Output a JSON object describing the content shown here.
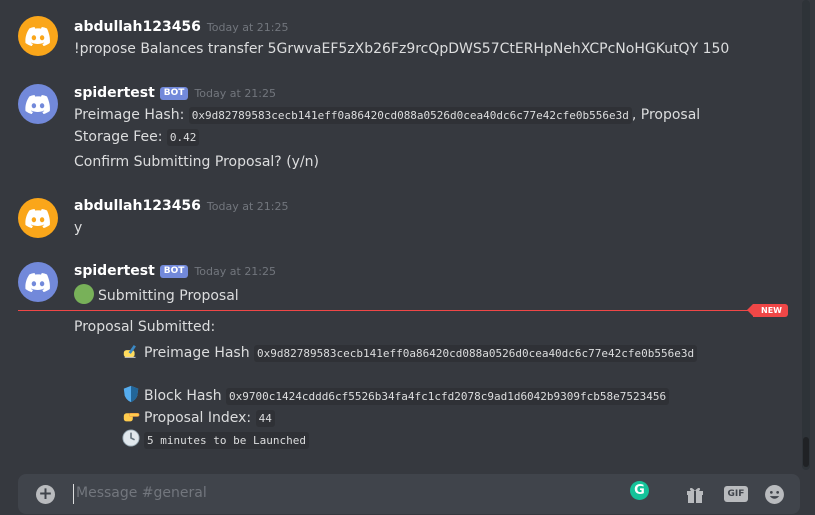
{
  "messages": [
    {
      "author": "abdullah123456",
      "timestamp": "Today at 21:25",
      "text": "!propose Balances transfer 5GrwvaEF5zXb26Fz9rcQpDWS57CtERHpNehXCPcNoHGKutQY 150"
    },
    {
      "author": "spidertest",
      "bot_badge": "BOT",
      "timestamp": "Today at 21:25",
      "preimage_label": "Preimage Hash:",
      "preimage_hash": "0x9d82789583cecb141eff0a86420cd088a0526d0cea40dc6c77e42cfe0b556e3d",
      "proposal_suffix": ", Proposal",
      "storage_fee_label": "Storage Fee:",
      "storage_fee": "0.42",
      "confirm": "Confirm Submitting Proposal? (y/n)"
    },
    {
      "author": "abdullah123456",
      "timestamp": "Today at 21:25",
      "text": "y"
    },
    {
      "author": "spidertest",
      "bot_badge": "BOT",
      "timestamp": "Today at 21:25",
      "submitting": "Submitting Proposal",
      "submitted": "Proposal Submitted:",
      "preimage_label": "Preimage Hash",
      "preimage_hash": "0x9d82789583cecb141eff0a86420cd088a0526d0cea40dc6c77e42cfe0b556e3d",
      "block_label": "Block Hash",
      "block_hash": "0x9700c1424cddd6cf5526b34fa4fc1cfd2078c9ad1d6042b9309fcb58e7523456",
      "index_label": "Proposal Index:",
      "index_value": "44",
      "launch_time": "5 minutes to be Launched"
    }
  ],
  "new_badge": "NEW",
  "composer": {
    "placeholder": "Message #general",
    "gif_label": "GIF",
    "grammarly_label": "G"
  },
  "colors": {
    "background": "#36393f",
    "accent": "#7289da",
    "new_divider": "#f04747",
    "avatar_user": "#faa61a",
    "avatar_bot": "#7289da"
  }
}
